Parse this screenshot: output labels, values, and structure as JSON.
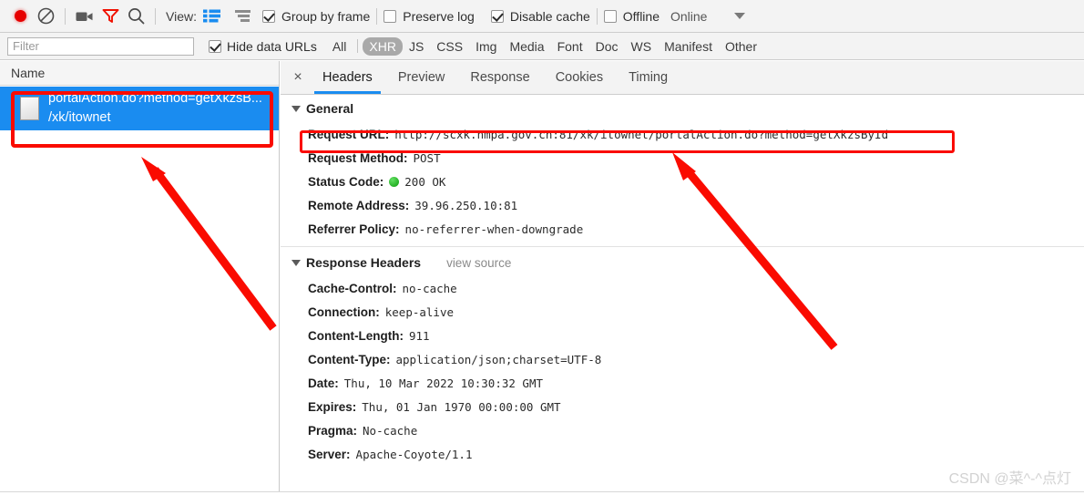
{
  "toolbar": {
    "icons": [
      {
        "name": "record-button",
        "glyph": "record-dot"
      },
      {
        "name": "clear-button",
        "glyph": "circle-slash"
      },
      {
        "name": "screenshot-capture-button",
        "glyph": "camera"
      },
      {
        "name": "filter-button",
        "glyph": "funnel"
      },
      {
        "name": "search-button",
        "glyph": "magnifier"
      }
    ],
    "view_label": "View:",
    "view_list_icon": "list-view-icon",
    "view_waterfall_icon": "waterfall-view-icon",
    "group_by_frame": {
      "label": "Group by frame",
      "checked": true
    },
    "preserve_log": {
      "label": "Preserve log",
      "checked": false
    },
    "disable_cache": {
      "label": "Disable cache",
      "checked": true
    },
    "offline": {
      "label": "Offline",
      "checked": false
    },
    "online_label": "Online",
    "throttle_caret": "chevron-down-icon"
  },
  "filterbar": {
    "filter_placeholder": "Filter",
    "filter_value": "",
    "hide_data_urls": {
      "label": "Hide data URLs",
      "checked": true
    },
    "types": [
      {
        "label": "All",
        "selected": false
      },
      {
        "label": "XHR",
        "selected": true
      },
      {
        "label": "JS",
        "selected": false
      },
      {
        "label": "CSS",
        "selected": false
      },
      {
        "label": "Img",
        "selected": false
      },
      {
        "label": "Media",
        "selected": false
      },
      {
        "label": "Font",
        "selected": false
      },
      {
        "label": "Doc",
        "selected": false
      },
      {
        "label": "WS",
        "selected": false
      },
      {
        "label": "Manifest",
        "selected": false
      },
      {
        "label": "Other",
        "selected": false
      }
    ]
  },
  "request_list": {
    "column_header": "Name",
    "selected_request": {
      "name_line1": "portalAction.do?method=getXkzsB...",
      "name_line2": "/xk/itownet",
      "icon": "document-icon",
      "selected": true
    }
  },
  "detail": {
    "close_glyph": "×",
    "tabs": [
      {
        "label": "Headers",
        "active": true
      },
      {
        "label": "Preview",
        "active": false
      },
      {
        "label": "Response",
        "active": false
      },
      {
        "label": "Cookies",
        "active": false
      },
      {
        "label": "Timing",
        "active": false
      }
    ],
    "general": {
      "title": "General",
      "rows": [
        {
          "key": "Request URL:",
          "value": "http://scxk.nmpa.gov.cn:81/xk/itownet/portalAction.do?method=getXkzsById",
          "highlighted": true
        },
        {
          "key": "Request Method:",
          "value": "POST"
        },
        {
          "key": "Status Code:",
          "value": "200 OK",
          "status_dot": true
        },
        {
          "key": "Remote Address:",
          "value": "39.96.250.10:81"
        },
        {
          "key": "Referrer Policy:",
          "value": "no-referrer-when-downgrade"
        }
      ]
    },
    "response_headers": {
      "title": "Response Headers",
      "view_source": "view source",
      "rows": [
        {
          "key": "Cache-Control:",
          "value": "no-cache"
        },
        {
          "key": "Connection:",
          "value": "keep-alive"
        },
        {
          "key": "Content-Length:",
          "value": "911"
        },
        {
          "key": "Content-Type:",
          "value": "application/json;charset=UTF-8"
        },
        {
          "key": "Date:",
          "value": "Thu, 10 Mar 2022 10:30:32 GMT"
        },
        {
          "key": "Expires:",
          "value": "Thu, 01 Jan 1970 00:00:00 GMT"
        },
        {
          "key": "Pragma:",
          "value": "No-cache"
        },
        {
          "key": "Server:",
          "value": "Apache-Coyote/1.1"
        }
      ]
    }
  },
  "annotations": {
    "color": "#fa0b00",
    "arrow_left": "arrow-pointing-to-selected-request",
    "arrow_right": "arrow-pointing-to-request-url",
    "box_request_row": "highlight-box-request-row",
    "box_request_url": "highlight-box-request-url"
  },
  "watermark": {
    "text": "CSDN @菜^-^点灯"
  }
}
